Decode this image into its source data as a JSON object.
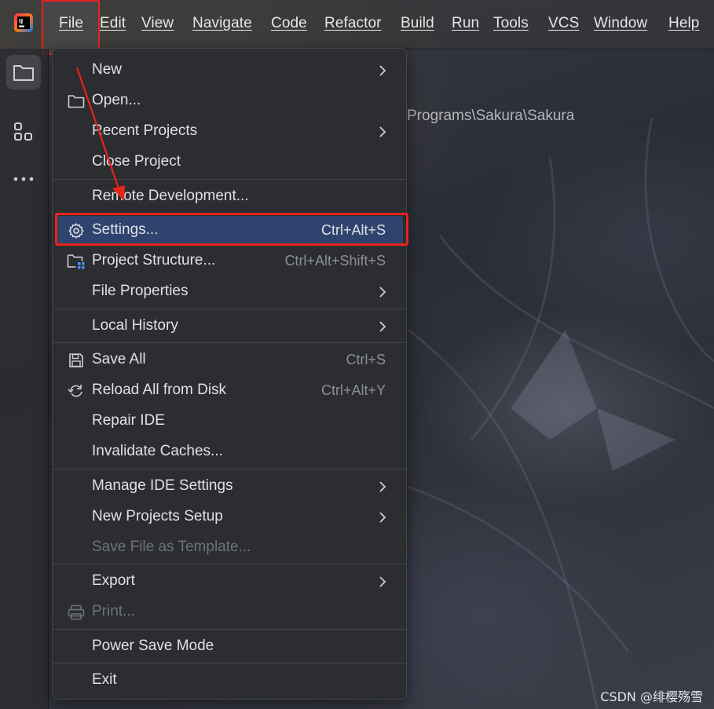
{
  "menubar": {
    "items": [
      "File",
      "Edit",
      "View",
      "Navigate",
      "Code",
      "Refactor",
      "Build",
      "Run",
      "Tools",
      "VCS",
      "Window",
      "Help"
    ]
  },
  "project_path": "Programs\\Sakura\\Sakura",
  "file_menu": {
    "new": "New",
    "open": "Open...",
    "recent_projects": "Recent Projects",
    "close_project": "Close Project",
    "remote_development": "Remote Development...",
    "settings": "Settings...",
    "settings_shortcut": "Ctrl+Alt+S",
    "project_structure": "Project Structure...",
    "project_structure_shortcut": "Ctrl+Alt+Shift+S",
    "file_properties": "File Properties",
    "local_history": "Local History",
    "save_all": "Save All",
    "save_all_shortcut": "Ctrl+S",
    "reload_all": "Reload All from Disk",
    "reload_all_shortcut": "Ctrl+Alt+Y",
    "repair_ide": "Repair IDE",
    "invalidate_caches": "Invalidate Caches...",
    "manage_ide_settings": "Manage IDE Settings",
    "new_projects_setup": "New Projects Setup",
    "save_file_as_template": "Save File as Template...",
    "export": "Export",
    "print": "Print...",
    "power_save_mode": "Power Save Mode",
    "exit": "Exit"
  },
  "watermark": "CSDN @绯樱殇雪",
  "colors": {
    "highlight": "#2e436e",
    "annotation_red": "#e8231c"
  }
}
